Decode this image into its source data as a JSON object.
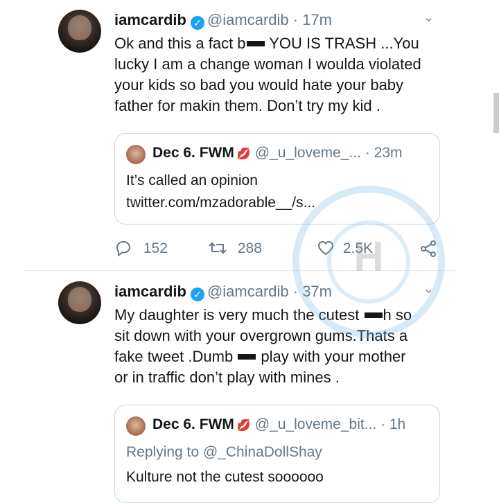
{
  "tweets": [
    {
      "name": "iamcardib",
      "handle": "@iamcardib · 17m",
      "text_a": "Ok and this a fact b",
      "text_b": " YOU IS TRASH ...You",
      "lines": [
        "lucky I am a change woman I woulda violated",
        "your kids so bad you would hate your baby",
        "father for makin them. Don’t try my kid ."
      ],
      "quote": {
        "name": "Dec 6. FWM",
        "meta": "@_u_loveme_... · 23m",
        "line1": "It’s called an opinion",
        "line2": "twitter.com/mzadorable__/s..."
      },
      "actions": {
        "replies": "152",
        "retweets": "288",
        "likes": "2.5K"
      }
    },
    {
      "name": "iamcardib",
      "handle": "@iamcardib · 37m",
      "line1_a": "My daughter is very much the cutest ",
      "line1_b": "h so",
      "line2": "sit down with your overgrown gums.Thats a",
      "line3_a": "fake tweet .Dumb ",
      "line3_b": " play with your mother",
      "line4": "or in traffic don’t play with mines .",
      "quote": {
        "name": "Dec 6. FWM",
        "meta": "@_u_loveme_bit... · 1h",
        "replying": "Replying to @_ChinaDollShay",
        "text": "Kulture not the cutest soooooo"
      }
    }
  ],
  "icons": {
    "verified": "✓",
    "chevron": "⌄",
    "reply": "reply-icon",
    "retweet": "retweet-icon",
    "like": "heart-icon",
    "share": "share-icon",
    "lips": "💋"
  },
  "colors": {
    "accent": "#1da1f2",
    "muted": "#657786",
    "lips": "#e0245e"
  }
}
